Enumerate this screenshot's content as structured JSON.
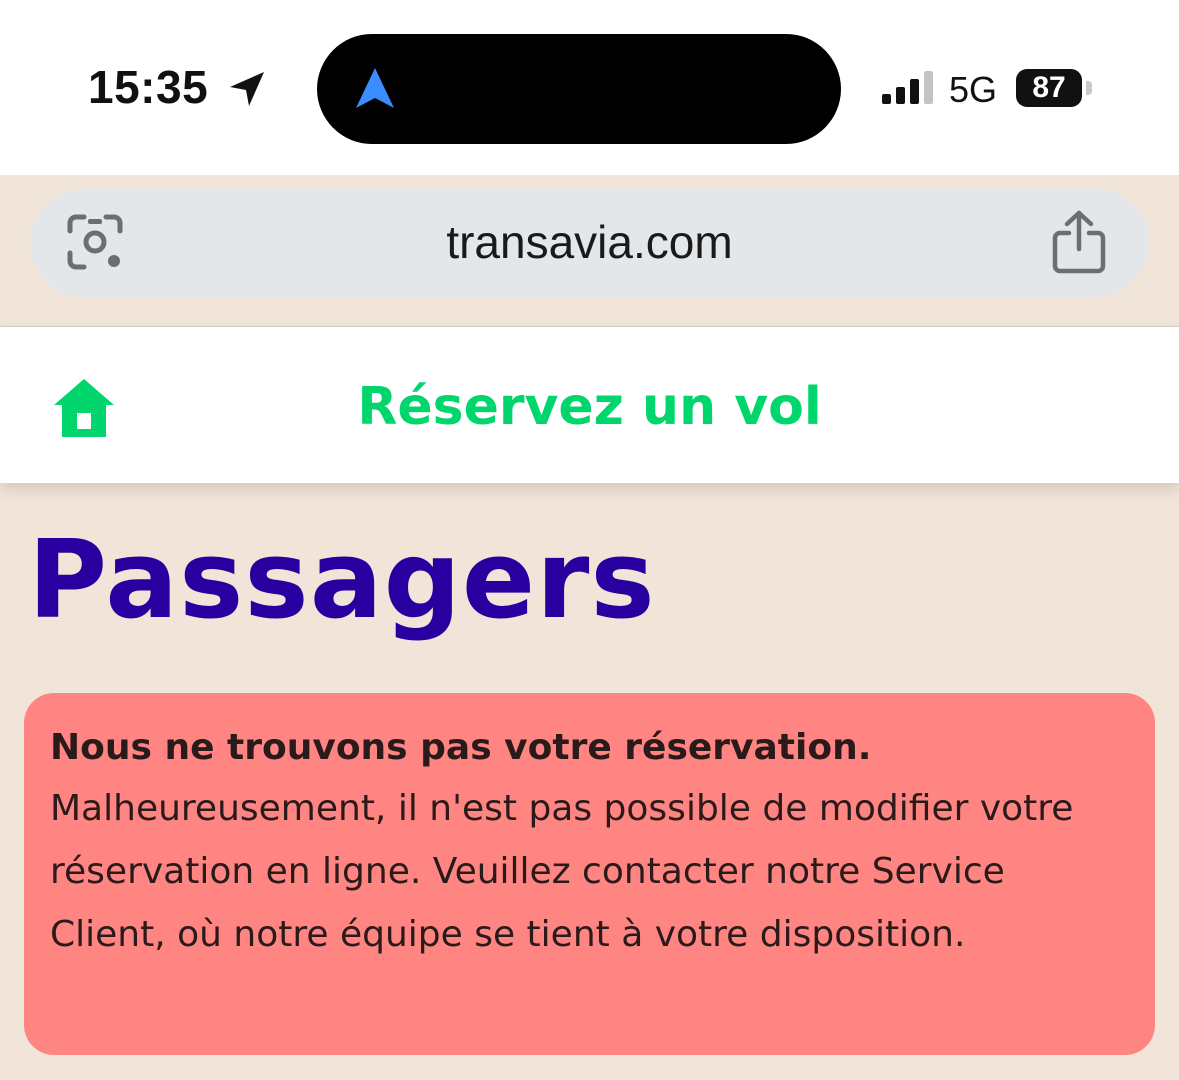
{
  "status_bar": {
    "time": "15:35",
    "network": "5G",
    "battery": "87",
    "icons": [
      "location-arrow-icon",
      "navigation-arrow-icon",
      "signal-icon",
      "battery-icon"
    ]
  },
  "browser": {
    "url": "transavia.com",
    "icons": [
      "camera-lens-icon",
      "share-icon"
    ]
  },
  "header": {
    "title": "Réservez un vol",
    "icons": [
      "home-icon"
    ],
    "accent_color": "#00d66c"
  },
  "page": {
    "title": "Passagers",
    "title_color": "#2800a0",
    "background_color": "#f1e4d8"
  },
  "alert": {
    "title": "Nous ne trouvons pas votre réservation.",
    "body": "Malheureusement, il n'est pas possible de modifier votre réservation en ligne. Veuillez contacter notre Service Client, où notre équipe se tient à votre disposition.",
    "background_color": "#ff8583"
  }
}
